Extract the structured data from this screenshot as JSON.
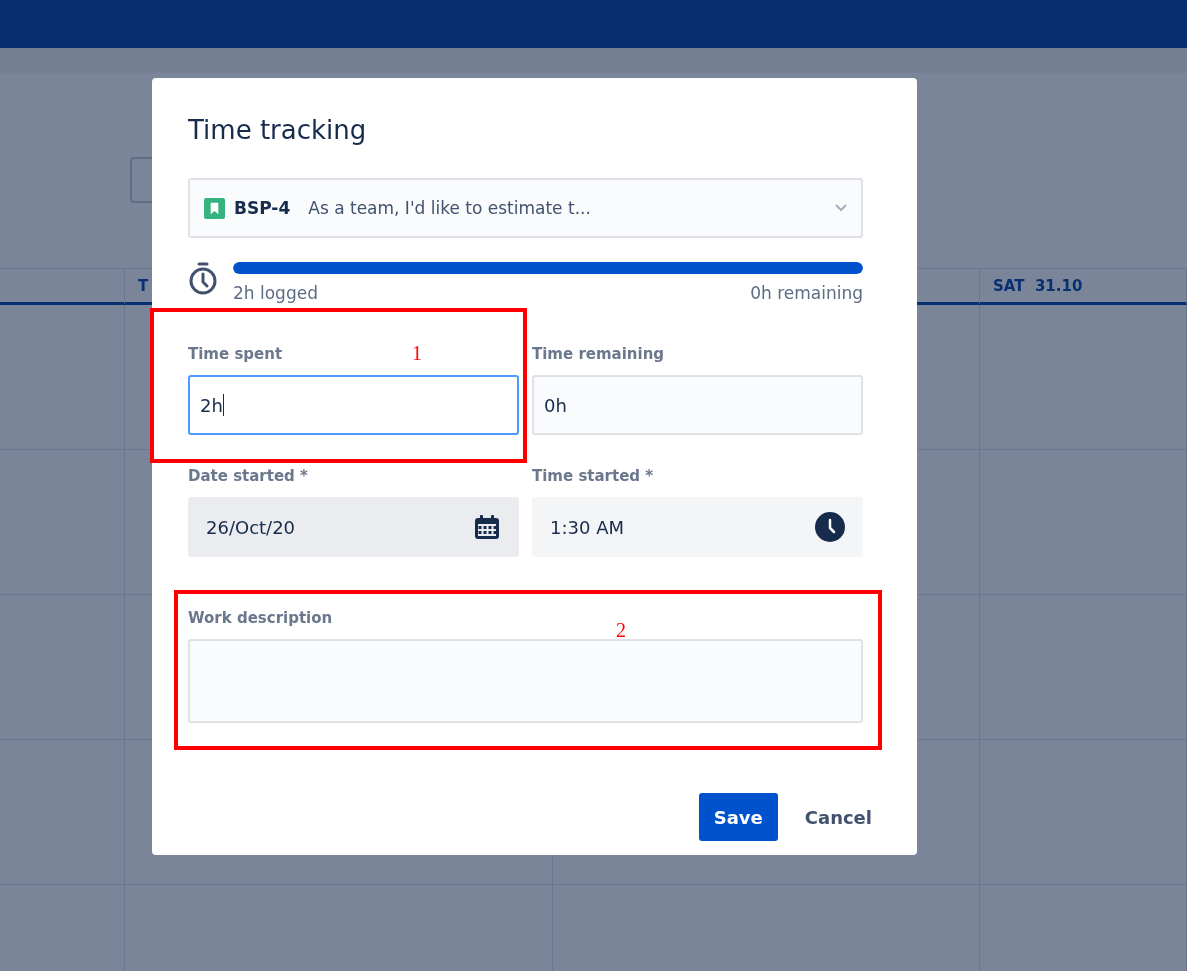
{
  "calendar": {
    "columns": [
      {
        "label": "T"
      },
      {
        "label": "SAT  31.10"
      }
    ]
  },
  "dialog": {
    "title": "Time tracking",
    "issue": {
      "key": "BSP-4",
      "summary": "As a team, I'd like to estimate t..."
    },
    "progress": {
      "level": 1,
      "logged": "2h logged",
      "remaining": "0h remaining"
    },
    "fields": [
      {
        "kind": "text",
        "label": "Time spent",
        "value": "2h",
        "focused": true
      },
      {
        "kind": "text",
        "label": "Time remaining",
        "value": "0h",
        "focused": false
      },
      {
        "kind": "date",
        "label": "Date started *",
        "value": "26/Oct/20",
        "focused": false
      },
      {
        "kind": "time",
        "label": "Time started *",
        "value": "1:30 AM",
        "focused": false
      }
    ],
    "description": {
      "label": "Work description"
    },
    "buttons": [
      {
        "label": "Save",
        "kind": "primary"
      },
      {
        "label": "Cancel",
        "kind": "subtle"
      }
    ]
  },
  "annotations": [
    {
      "label": "1"
    },
    {
      "label": "2"
    }
  ]
}
